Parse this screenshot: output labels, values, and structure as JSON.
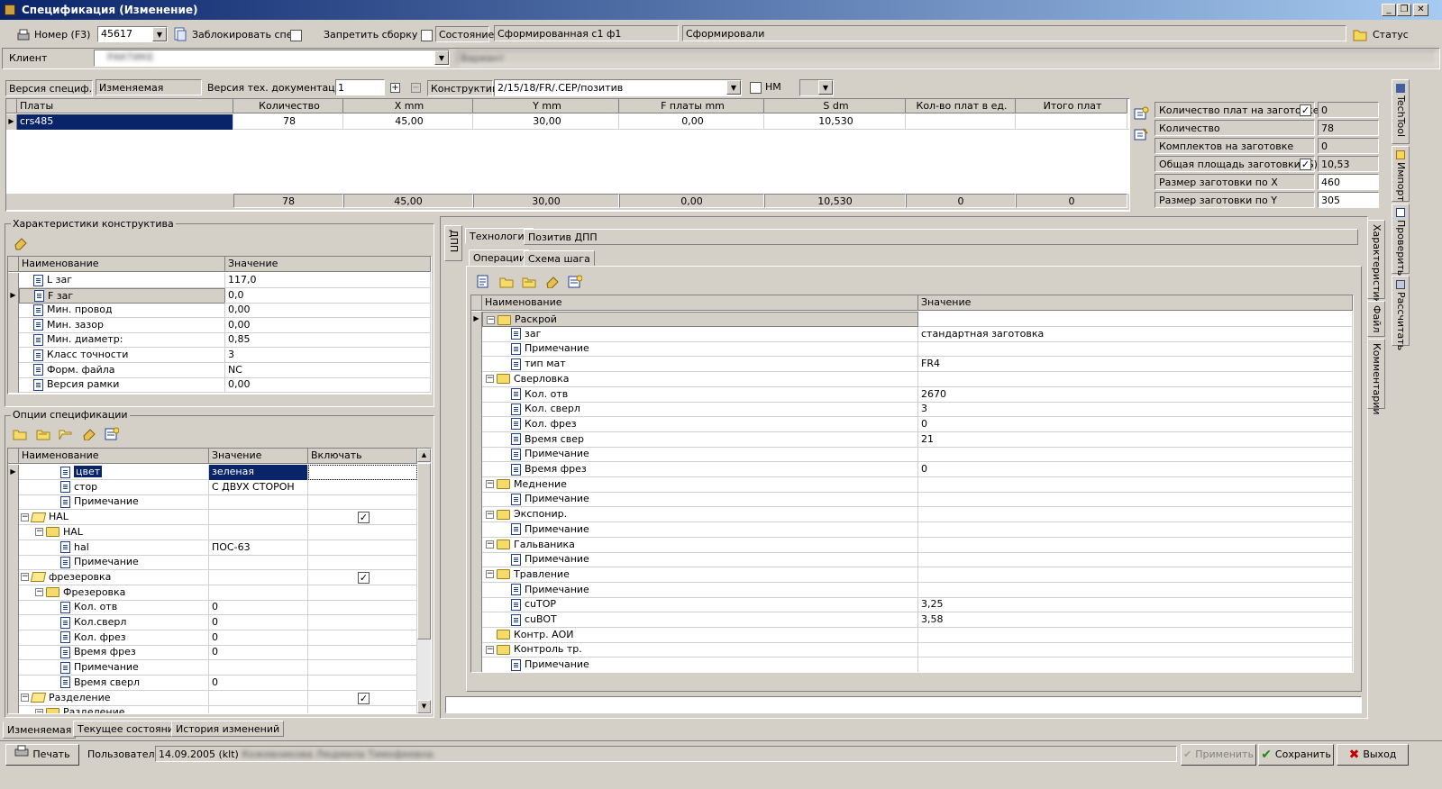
{
  "window": {
    "title": "Спецификация (Изменение)",
    "min": "_",
    "restore": "❐",
    "close": "✕"
  },
  "toolbar": {
    "number_label": "Номер (F3)",
    "number_value": "45617",
    "lock_label": "Заблокировать спец.",
    "forbid_label": "Запретить сборку",
    "state_label": "Состояние",
    "state_value": "Сформированная с1 ф1",
    "formed_value": "Сформировали",
    "status_label": "Статус"
  },
  "client": {
    "label": "Клиент",
    "value": "РАКТИКЕ",
    "variant": "Вариант"
  },
  "version_bar": {
    "spec_version_label": "Версия специф.",
    "spec_version_value": "Изменяемая",
    "tech_doc_label": "Версия тех. документации",
    "tech_doc_value": "1",
    "constructive_label": "Конструктив",
    "constructive_value": "2/15/18/FR/.CEP/позитив",
    "nm_label": "НМ"
  },
  "boards": {
    "columns": [
      "Платы",
      "Количество",
      "X mm",
      "Y mm",
      "F платы mm",
      "S dm",
      "Кол-во плат в ед.",
      "Итого плат"
    ],
    "rows": [
      [
        "crs485",
        "78",
        "45,00",
        "30,00",
        "0,00",
        "10,530",
        "",
        ""
      ]
    ],
    "totals": [
      "78",
      "45,00",
      "30,00",
      "0,00",
      "10,530",
      "0",
      "0"
    ]
  },
  "blank": {
    "rows": [
      {
        "label": "Количество плат на заготовке",
        "value": "0",
        "checked": true
      },
      {
        "label": "Количество",
        "value": "78"
      },
      {
        "label": "Комплектов на заготовке",
        "value": "0"
      },
      {
        "label": "Общая площадь заготовки (S)",
        "value": "10,53",
        "checked": true
      },
      {
        "label": "Размер заготовки по X",
        "value": "460"
      },
      {
        "label": "Размер заготовки по Y",
        "value": "305"
      }
    ]
  },
  "char_panel": {
    "title": "Характеристики конструктива",
    "columns": [
      "Наименование",
      "Значение"
    ],
    "rows": [
      [
        "L заг",
        "117,0"
      ],
      [
        "F заг",
        "0,0"
      ],
      [
        "Мин. провод",
        "0,00"
      ],
      [
        "Мин. зазор",
        "0,00"
      ],
      [
        "Мин. диаметр:",
        "0,85"
      ],
      [
        "Класс точности",
        "3"
      ],
      [
        "Форм. файла",
        "NC"
      ],
      [
        "Версия рамки",
        "0,00"
      ]
    ]
  },
  "options_panel": {
    "title": "Опции спецификации",
    "columns": [
      "Наименование",
      "Значение",
      "Включать"
    ],
    "rows": [
      {
        "lvl": 3,
        "kind": "doc",
        "name": "цвет",
        "value": "зеленая",
        "sel": true
      },
      {
        "lvl": 3,
        "kind": "doc",
        "name": "стор",
        "value": "С ДВУХ СТОРОН"
      },
      {
        "lvl": 3,
        "kind": "doc",
        "name": "Примечание",
        "value": ""
      },
      {
        "lvl": 1,
        "kind": "open",
        "name": "HAL",
        "value": "",
        "chk": true
      },
      {
        "lvl": 2,
        "kind": "fold",
        "name": "HAL",
        "value": ""
      },
      {
        "lvl": 3,
        "kind": "doc",
        "name": "hal",
        "value": "ПОС-63"
      },
      {
        "lvl": 3,
        "kind": "doc",
        "name": "Примечание",
        "value": ""
      },
      {
        "lvl": 1,
        "kind": "open",
        "name": "фрезеровка",
        "value": "",
        "chk": true
      },
      {
        "lvl": 2,
        "kind": "fold",
        "name": "Фрезеровка",
        "value": ""
      },
      {
        "lvl": 3,
        "kind": "doc",
        "name": "Кол. отв",
        "value": "0"
      },
      {
        "lvl": 3,
        "kind": "doc",
        "name": "Кол.сверл",
        "value": "0"
      },
      {
        "lvl": 3,
        "kind": "doc",
        "name": "Кол. фрез",
        "value": "0"
      },
      {
        "lvl": 3,
        "kind": "doc",
        "name": "Время фрез",
        "value": "0"
      },
      {
        "lvl": 3,
        "kind": "doc",
        "name": "Примечание",
        "value": ""
      },
      {
        "lvl": 3,
        "kind": "doc",
        "name": "Время сверл",
        "value": "0"
      },
      {
        "lvl": 1,
        "kind": "open",
        "name": "Разделение",
        "value": "",
        "chk": true
      },
      {
        "lvl": 2,
        "kind": "fold",
        "name": "Разделение",
        "value": ""
      }
    ]
  },
  "left_tabs": [
    "Изменяемая",
    "Текущее состояние",
    "История изменений"
  ],
  "dpp": {
    "side_tab": "ДПП",
    "tabs": [
      "Технология",
      "Позитив ДПП"
    ],
    "subtabs": [
      "Операции",
      "Схема шага"
    ],
    "columns": [
      "Наименование",
      "Значение"
    ],
    "rows": [
      {
        "lvl": 1,
        "kind": "fold",
        "name": "Раскрой",
        "value": "",
        "sel": true
      },
      {
        "lvl": 2,
        "kind": "doc",
        "name": "заг",
        "value": "стандартная заготовка"
      },
      {
        "lvl": 2,
        "kind": "doc",
        "name": "Примечание",
        "value": ""
      },
      {
        "lvl": 2,
        "kind": "doc",
        "name": "тип мат",
        "value": "FR4"
      },
      {
        "lvl": 1,
        "kind": "fold",
        "name": "Сверловка",
        "value": ""
      },
      {
        "lvl": 2,
        "kind": "doc",
        "name": "Кол. отв",
        "value": "2670"
      },
      {
        "lvl": 2,
        "kind": "doc",
        "name": "Кол. сверл",
        "value": "3"
      },
      {
        "lvl": 2,
        "kind": "doc",
        "name": "Кол. фрез",
        "value": "0"
      },
      {
        "lvl": 2,
        "kind": "doc",
        "name": "Время свер",
        "value": "21"
      },
      {
        "lvl": 2,
        "kind": "doc",
        "name": "Примечание",
        "value": ""
      },
      {
        "lvl": 2,
        "kind": "doc",
        "name": "Время фрез",
        "value": "0"
      },
      {
        "lvl": 1,
        "kind": "fold",
        "name": "Меднение",
        "value": ""
      },
      {
        "lvl": 2,
        "kind": "doc",
        "name": "Примечание",
        "value": ""
      },
      {
        "lvl": 1,
        "kind": "fold",
        "name": "Экспонир.",
        "value": ""
      },
      {
        "lvl": 2,
        "kind": "doc",
        "name": "Примечание",
        "value": ""
      },
      {
        "lvl": 1,
        "kind": "fold",
        "name": "Гальваника",
        "value": ""
      },
      {
        "lvl": 2,
        "kind": "doc",
        "name": "Примечание",
        "value": ""
      },
      {
        "lvl": 1,
        "kind": "fold",
        "name": "Травление",
        "value": ""
      },
      {
        "lvl": 2,
        "kind": "doc",
        "name": "Примечание",
        "value": ""
      },
      {
        "lvl": 2,
        "kind": "doc",
        "name": "cuTOP",
        "value": "3,25"
      },
      {
        "lvl": 2,
        "kind": "doc",
        "name": "cuBOT",
        "value": "3,58"
      },
      {
        "lvl": 1,
        "kind": "leaf",
        "name": "Контр. АОИ",
        "value": ""
      },
      {
        "lvl": 1,
        "kind": "fold",
        "name": "Контроль тр.",
        "value": ""
      },
      {
        "lvl": 2,
        "kind": "doc",
        "name": "Примечание",
        "value": ""
      }
    ]
  },
  "right_tabs_inner": [
    "Характеристики",
    "Файл",
    "Комментарии"
  ],
  "right_tabs_outer": [
    "TechTool",
    "Импорт",
    "Проверить",
    "Рассчитать"
  ],
  "footer": {
    "print": "Печать",
    "user_label": "Пользователь",
    "user_value": "14.09.2005 (klt)",
    "user_name": "Кожевникова Людмила Тимофеевна",
    "apply": "Применить",
    "save": "Сохранить",
    "exit": "Выход"
  }
}
